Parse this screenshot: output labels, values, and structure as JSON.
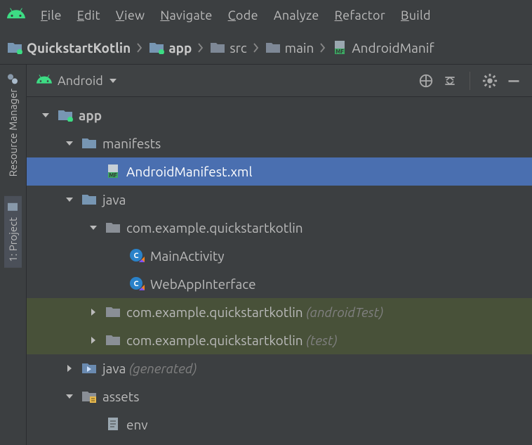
{
  "menu": {
    "file": "File",
    "edit": "Edit",
    "view": "View",
    "navigate": "Navigate",
    "code": "Code",
    "analyze": "Analyze",
    "refactor": "Refactor",
    "build": "Build"
  },
  "breadcrumb": {
    "project": "QuickstartKotlin",
    "module": "app",
    "src": "src",
    "main": "main",
    "file": "AndroidManif"
  },
  "toolstrip": {
    "resource_manager": "Resource Manager",
    "project": "1: Project"
  },
  "panel": {
    "selector": "Android"
  },
  "tree": {
    "app": "app",
    "manifests": "manifests",
    "manifest_file": "AndroidManifest.xml",
    "java": "java",
    "pkg_main": "com.example.quickstartkotlin",
    "cls_main_activity": "MainActivity",
    "cls_webapp": "WebAppInterface",
    "pkg_android_test": "com.example.quickstartkotlin",
    "pkg_android_test_suffix": "(androidTest)",
    "pkg_test": "com.example.quickstartkotlin",
    "pkg_test_suffix": "(test)",
    "java_gen": "java",
    "java_gen_suffix": "(generated)",
    "assets": "assets",
    "env": "env"
  }
}
